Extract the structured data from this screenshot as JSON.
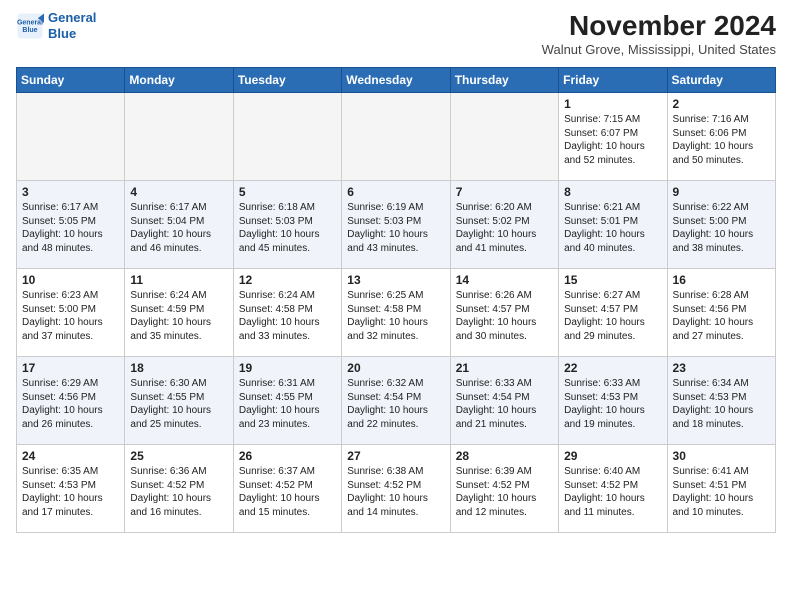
{
  "brand": {
    "line1": "General",
    "line2": "Blue"
  },
  "title": "November 2024",
  "location": "Walnut Grove, Mississippi, United States",
  "weekdays": [
    "Sunday",
    "Monday",
    "Tuesday",
    "Wednesday",
    "Thursday",
    "Friday",
    "Saturday"
  ],
  "weeks": [
    [
      {
        "day": "",
        "content": ""
      },
      {
        "day": "",
        "content": ""
      },
      {
        "day": "",
        "content": ""
      },
      {
        "day": "",
        "content": ""
      },
      {
        "day": "",
        "content": ""
      },
      {
        "day": "1",
        "content": "Sunrise: 7:15 AM\nSunset: 6:07 PM\nDaylight: 10 hours\nand 52 minutes."
      },
      {
        "day": "2",
        "content": "Sunrise: 7:16 AM\nSunset: 6:06 PM\nDaylight: 10 hours\nand 50 minutes."
      }
    ],
    [
      {
        "day": "3",
        "content": "Sunrise: 6:17 AM\nSunset: 5:05 PM\nDaylight: 10 hours\nand 48 minutes."
      },
      {
        "day": "4",
        "content": "Sunrise: 6:17 AM\nSunset: 5:04 PM\nDaylight: 10 hours\nand 46 minutes."
      },
      {
        "day": "5",
        "content": "Sunrise: 6:18 AM\nSunset: 5:03 PM\nDaylight: 10 hours\nand 45 minutes."
      },
      {
        "day": "6",
        "content": "Sunrise: 6:19 AM\nSunset: 5:03 PM\nDaylight: 10 hours\nand 43 minutes."
      },
      {
        "day": "7",
        "content": "Sunrise: 6:20 AM\nSunset: 5:02 PM\nDaylight: 10 hours\nand 41 minutes."
      },
      {
        "day": "8",
        "content": "Sunrise: 6:21 AM\nSunset: 5:01 PM\nDaylight: 10 hours\nand 40 minutes."
      },
      {
        "day": "9",
        "content": "Sunrise: 6:22 AM\nSunset: 5:00 PM\nDaylight: 10 hours\nand 38 minutes."
      }
    ],
    [
      {
        "day": "10",
        "content": "Sunrise: 6:23 AM\nSunset: 5:00 PM\nDaylight: 10 hours\nand 37 minutes."
      },
      {
        "day": "11",
        "content": "Sunrise: 6:24 AM\nSunset: 4:59 PM\nDaylight: 10 hours\nand 35 minutes."
      },
      {
        "day": "12",
        "content": "Sunrise: 6:24 AM\nSunset: 4:58 PM\nDaylight: 10 hours\nand 33 minutes."
      },
      {
        "day": "13",
        "content": "Sunrise: 6:25 AM\nSunset: 4:58 PM\nDaylight: 10 hours\nand 32 minutes."
      },
      {
        "day": "14",
        "content": "Sunrise: 6:26 AM\nSunset: 4:57 PM\nDaylight: 10 hours\nand 30 minutes."
      },
      {
        "day": "15",
        "content": "Sunrise: 6:27 AM\nSunset: 4:57 PM\nDaylight: 10 hours\nand 29 minutes."
      },
      {
        "day": "16",
        "content": "Sunrise: 6:28 AM\nSunset: 4:56 PM\nDaylight: 10 hours\nand 27 minutes."
      }
    ],
    [
      {
        "day": "17",
        "content": "Sunrise: 6:29 AM\nSunset: 4:56 PM\nDaylight: 10 hours\nand 26 minutes."
      },
      {
        "day": "18",
        "content": "Sunrise: 6:30 AM\nSunset: 4:55 PM\nDaylight: 10 hours\nand 25 minutes."
      },
      {
        "day": "19",
        "content": "Sunrise: 6:31 AM\nSunset: 4:55 PM\nDaylight: 10 hours\nand 23 minutes."
      },
      {
        "day": "20",
        "content": "Sunrise: 6:32 AM\nSunset: 4:54 PM\nDaylight: 10 hours\nand 22 minutes."
      },
      {
        "day": "21",
        "content": "Sunrise: 6:33 AM\nSunset: 4:54 PM\nDaylight: 10 hours\nand 21 minutes."
      },
      {
        "day": "22",
        "content": "Sunrise: 6:33 AM\nSunset: 4:53 PM\nDaylight: 10 hours\nand 19 minutes."
      },
      {
        "day": "23",
        "content": "Sunrise: 6:34 AM\nSunset: 4:53 PM\nDaylight: 10 hours\nand 18 minutes."
      }
    ],
    [
      {
        "day": "24",
        "content": "Sunrise: 6:35 AM\nSunset: 4:53 PM\nDaylight: 10 hours\nand 17 minutes."
      },
      {
        "day": "25",
        "content": "Sunrise: 6:36 AM\nSunset: 4:52 PM\nDaylight: 10 hours\nand 16 minutes."
      },
      {
        "day": "26",
        "content": "Sunrise: 6:37 AM\nSunset: 4:52 PM\nDaylight: 10 hours\nand 15 minutes."
      },
      {
        "day": "27",
        "content": "Sunrise: 6:38 AM\nSunset: 4:52 PM\nDaylight: 10 hours\nand 14 minutes."
      },
      {
        "day": "28",
        "content": "Sunrise: 6:39 AM\nSunset: 4:52 PM\nDaylight: 10 hours\nand 12 minutes."
      },
      {
        "day": "29",
        "content": "Sunrise: 6:40 AM\nSunset: 4:52 PM\nDaylight: 10 hours\nand 11 minutes."
      },
      {
        "day": "30",
        "content": "Sunrise: 6:41 AM\nSunset: 4:51 PM\nDaylight: 10 hours\nand 10 minutes."
      }
    ]
  ]
}
